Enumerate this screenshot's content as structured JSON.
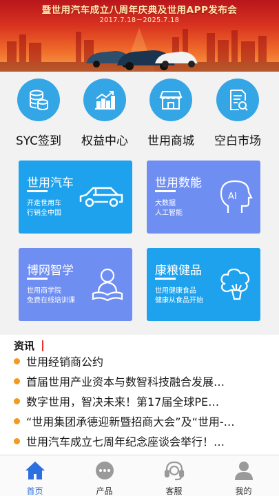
{
  "banner": {
    "title": "暨世用汽车成立八周年庆典及世用APP发布会",
    "date": "2017.7.18－2025.7.18"
  },
  "quick_links": [
    {
      "label": "SYC签到",
      "icon": "coins-stack-icon"
    },
    {
      "label": "权益中心",
      "icon": "growth-chart-icon"
    },
    {
      "label": "世用商城",
      "icon": "store-icon"
    },
    {
      "label": "空白市场",
      "icon": "document-search-icon"
    }
  ],
  "cards": [
    {
      "title": "世用汽车",
      "lines": [
        "开走世用车",
        "行销全中国"
      ],
      "icon": "car-icon"
    },
    {
      "title": "世用数能",
      "lines": [
        "大数据",
        "人工智能"
      ],
      "icon": "ai-head-icon"
    },
    {
      "title": "博网智学",
      "lines": [
        "世用商学院",
        "免费在线培训课"
      ],
      "icon": "reading-person-icon"
    },
    {
      "title": "康粮健品",
      "lines": [
        "世用健康食品",
        "健康从食品开始"
      ],
      "icon": "broccoli-icon"
    }
  ],
  "news": {
    "header": "资讯",
    "items": [
      "世用经销商公约",
      "首届世用产业资本与数智科技融合发展…",
      "数字世用，智决未来！第17届全球PE…",
      "“世用集团承德迎新暨招商大会”及“世用-…",
      "世用汽车成立七周年纪念座谈会举行！…"
    ]
  },
  "nav": [
    {
      "label": "首页",
      "icon": "home-icon",
      "active": true
    },
    {
      "label": "产品",
      "icon": "chat-dots-icon",
      "active": false
    },
    {
      "label": "客服",
      "icon": "headset-icon",
      "active": false
    },
    {
      "label": "我的",
      "icon": "user-icon",
      "active": false
    }
  ],
  "colors": {
    "accent_blue": "#1ea2ee",
    "card_purple": "#6f8ef2",
    "news_dot": "#f39a1e",
    "active_nav": "#2b6fe0"
  }
}
